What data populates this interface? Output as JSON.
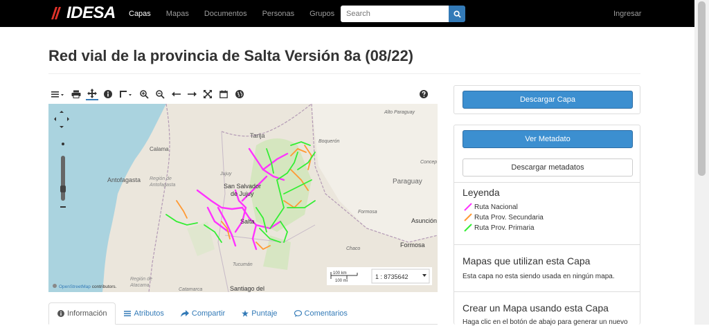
{
  "navbar": {
    "logo_text": "IDESA",
    "links": [
      {
        "label": "Capas",
        "active": true
      },
      {
        "label": "Mapas",
        "active": false
      },
      {
        "label": "Documentos",
        "active": false
      },
      {
        "label": "Personas",
        "active": false
      },
      {
        "label": "Grupos",
        "active": false
      }
    ],
    "search_placeholder": "Search",
    "login_label": "Ingresar"
  },
  "page": {
    "title": "Red vial de la provincia de Salta Versión 8a (08/22)"
  },
  "map": {
    "labels": {
      "alto_paraguay": "Alto Paraguay",
      "tarija": "Tarija",
      "boqueron": "Boquerón",
      "calama": "Calama",
      "concep": "Concep",
      "region_antofagasta_1": "Región de",
      "region_antofagasta_2": "Antofagasta",
      "jujuy": "Jujuy",
      "antofagasta": "Antofagasta",
      "san_salvador_1": "San Salvador",
      "san_salvador_2": "de Jujuy",
      "paraguay": "Paraguay",
      "formosa_region": "Formosa",
      "asuncion": "Asunción",
      "salta": "Salta",
      "chaco": "Chaco",
      "formosa_city": "Formosa",
      "tucuman": "Tucumán",
      "region_atacama_1": "Región de",
      "region_atacama_2": "Atacama",
      "catamarca": "Catamarca",
      "santiago": "Santiago del"
    },
    "scale_top": "100 km",
    "scale_bottom": "100 mi",
    "scale_ratio": "1 : 8735642",
    "attribution_link": "OpenStreetMap",
    "attribution_rest": " contributors."
  },
  "tabs": [
    {
      "label": "Información",
      "icon": "info-icon",
      "active": true
    },
    {
      "label": "Atributos",
      "icon": "list-icon",
      "active": false
    },
    {
      "label": "Compartir",
      "icon": "share-icon",
      "active": false
    },
    {
      "label": "Puntaje",
      "icon": "star-icon",
      "active": false
    },
    {
      "label": "Comentarios",
      "icon": "comment-icon",
      "active": false
    }
  ],
  "sidebar": {
    "download_layer": "Descargar Capa",
    "view_metadata": "Ver Metadato",
    "download_metadata": "Descargar metadatos",
    "legend_title": "Leyenda",
    "legend_items": [
      {
        "label": "Ruta Nacional",
        "color": "#ff33ff"
      },
      {
        "label": "Ruta Prov. Secundaria",
        "color": "#ff9933"
      },
      {
        "label": "Ruta Prov. Primaria",
        "color": "#33ee33"
      }
    ],
    "maps_title": "Mapas que utilizan esta Capa",
    "maps_text": "Esta capa no esta siendo usada en ningún mapa.",
    "create_title": "Crear un Mapa usando esta Capa",
    "create_text": "Haga clic en el botón de abajo para generar un nuevo"
  },
  "colors": {
    "navbar_bg": "#000000",
    "primary": "#3c8fd0",
    "link": "#337ab7",
    "sea": "#aad3df",
    "ruta_nacional": "#ff33ff",
    "ruta_secundaria": "#ff9933",
    "ruta_primaria": "#33ee33"
  }
}
